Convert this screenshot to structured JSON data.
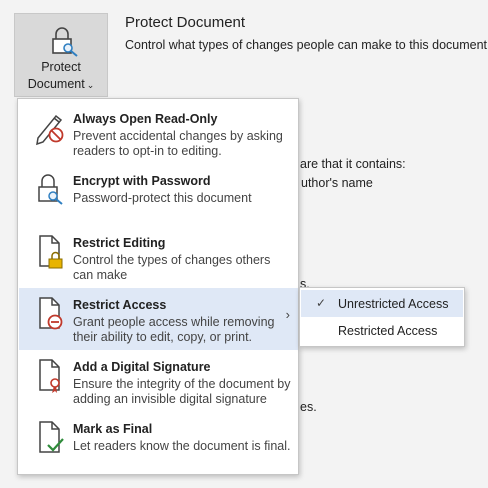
{
  "ribbon": {
    "button_line1": "Protect",
    "button_line2": "Document",
    "title": "Protect Document",
    "subtitle": "Control what types of changes people can make to this document."
  },
  "background_fragments": [
    "are that it contains:",
    "uthor's name",
    "s.",
    "es."
  ],
  "menu": {
    "items": [
      {
        "title": "Always Open Read-Only",
        "desc": "Prevent accidental changes by asking readers to opt-in to editing.",
        "icon": "pencil-prohibited-icon"
      },
      {
        "title": "Encrypt with Password",
        "desc": "Password-protect this document",
        "icon": "lock-key-icon"
      },
      {
        "title": "Restrict Editing",
        "desc": "Control the types of changes others can make",
        "icon": "document-lock-icon"
      },
      {
        "title": "Restrict Access",
        "desc": "Grant people access while removing their ability to edit, copy, or print.",
        "icon": "document-restricted-icon"
      },
      {
        "title": "Add a Digital Signature",
        "desc": "Ensure the integrity of the document by adding an invisible digital signature",
        "icon": "document-ribbon-icon"
      },
      {
        "title": "Mark as Final",
        "desc": "Let readers know the document is final.",
        "icon": "document-check-icon"
      }
    ]
  },
  "submenu": {
    "items": [
      {
        "label": "Unrestricted Access",
        "checked": true
      },
      {
        "label": "Restricted Access",
        "checked": false
      }
    ]
  },
  "colors": {
    "hover": "#dfe8f6",
    "accent_red": "#c0392b",
    "lock_yellow": "#e8b400",
    "check_green": "#2e8b3a",
    "key_blue": "#2f7fc1"
  }
}
